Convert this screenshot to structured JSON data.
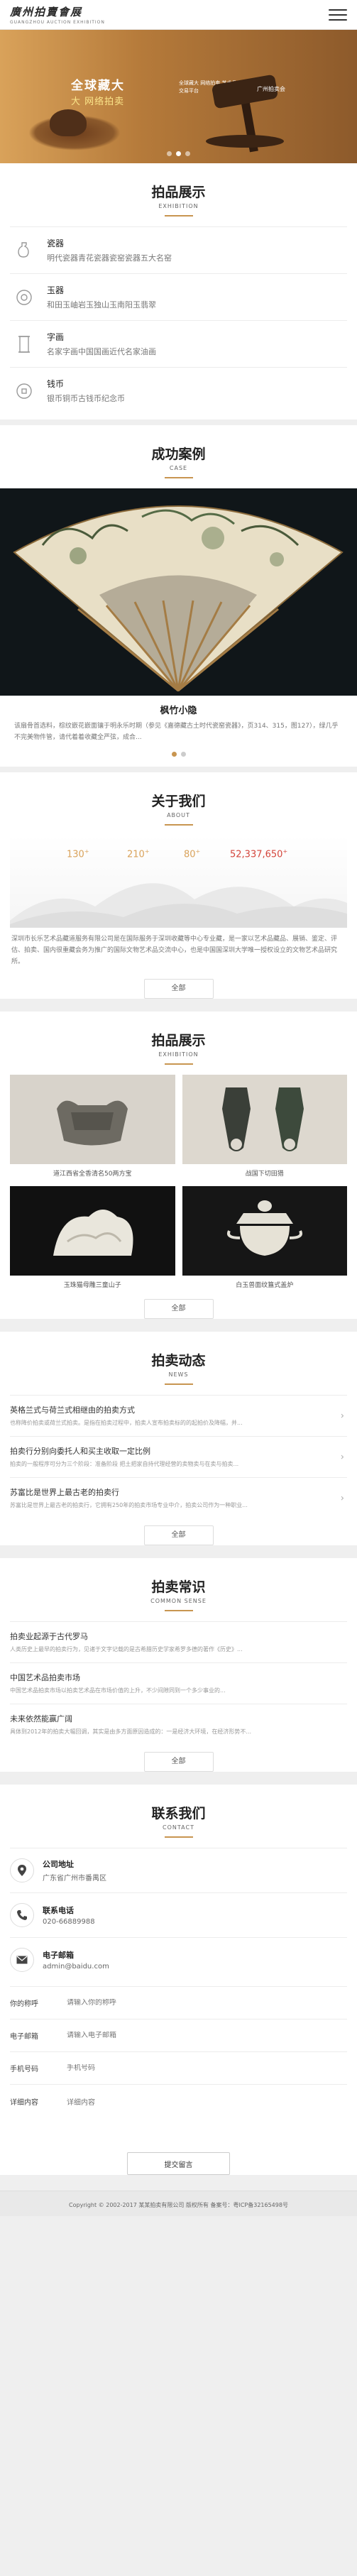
{
  "header": {
    "logo_cn": "廣州拍賣會展",
    "logo_en": "GUANGZHOU  AUCTION  EXHIBITION"
  },
  "banner": {
    "slogan1": "全球藏大",
    "slogan2": "大  网络拍卖",
    "tagline": "全球藏大 网络拍卖 艺术品交易平台",
    "tagline2": "广州拍卖会",
    "slides": 3,
    "active": 1
  },
  "products_section": {
    "title": "拍品展示",
    "subtitle": "EXHIBITION",
    "categories": [
      {
        "title": "瓷器",
        "desc": "明代瓷器青花瓷器瓷窑瓷器五大名窑",
        "icon": "vase-icon"
      },
      {
        "title": "玉器",
        "desc": "和田玉岫岩玉独山玉南阳玉翡翠",
        "icon": "jade-icon"
      },
      {
        "title": "字画",
        "desc": "名家字画中国国画近代名家油画",
        "icon": "scroll-icon"
      },
      {
        "title": "钱币",
        "desc": "银币铜币古钱币纪念币",
        "icon": "coin-icon"
      }
    ]
  },
  "case_section": {
    "title": "成功案例",
    "subtitle": "CASE",
    "item_title": "枫竹小隐",
    "item_desc": "该扇骨首选料，棕纹嵌花嵌面镶于明永乐时期（参见《嘉德藏古土时代瓷窑瓷器》，页314、315，图127），绿几乎不完美物件管，请代着着收藏全严弦，成合..."
  },
  "about_section": {
    "title": "关于我们",
    "subtitle": "ABOUT",
    "stats": [
      "130",
      "210",
      "80",
      "52,337,650"
    ],
    "text": "深圳市长乐艺术品藏道服务有限公司是在国际服务于深圳收藏等中心专业藏，是一家以艺术品藏品、展销、鉴定、评估、拍卖、国内很重藏会务为推广的国际文物艺术品交流中心，也是中国国深圳大学唯一授权设立的文物艺术品研究所。",
    "more": "全部"
  },
  "gallery_section": {
    "title": "拍品展示",
    "subtitle": "EXHIBITION",
    "items": [
      {
        "caption": "道江西省全香清名50两方宝"
      },
      {
        "caption": "战国下切田猎"
      },
      {
        "caption": "玉珠猫母雕三童山子"
      },
      {
        "caption": "白玉兽面纹簋式盖炉"
      }
    ],
    "more": "全部"
  },
  "news_section": {
    "title": "拍卖动态",
    "subtitle": "NEWS",
    "items": [
      {
        "title": "英格兰式与荷兰式相继由的拍卖方式",
        "desc": "也称降价拍卖或荷兰式拍卖。是指在拍卖过程中，拍卖人宣布拍卖标的的起拍价及降幅，并..."
      },
      {
        "title": "拍卖行分别向委托人和买主收取一定比例",
        "desc": "拍卖的一般程序可分为三个阶段：准备阶段 把土把家自持代理经营的卖物卖与在卖与拍卖..."
      },
      {
        "title": "苏富比是世界上最古老的拍卖行",
        "desc": "苏富比是世界上最古老的拍卖行，它拥有250年的拍卖市场专业中介，拍卖公司作为一种职业..."
      }
    ],
    "more": "全部"
  },
  "knowledge_section": {
    "title": "拍卖常识",
    "subtitle": "COMMON SENSE",
    "items": [
      {
        "title": "拍卖业起源于古代罗马",
        "desc": "人类历史上最早的拍卖行为，见诸于文字记载的是古希腊历史学家希罗多德的著作《历史》..."
      },
      {
        "title": "中国艺术品拍卖市场",
        "desc": "中国艺术品拍卖市场以拍卖艺术品在市场价值的上升，不少间隙同到一个多少事业的..."
      },
      {
        "title": "未来依然能赢广阔",
        "desc": "具体到2012年的拍卖大幅回调，其实是由多方面原因造成的：一是经济大环境，在经济形势不..."
      }
    ],
    "more": "全部"
  },
  "contact_section": {
    "title": "联系我们",
    "subtitle": "CONTACT",
    "items": [
      {
        "title": "公司地址",
        "value": "广东省广州市番禺区",
        "icon": "location-icon"
      },
      {
        "title": "联系电话",
        "value": "020-66889988",
        "icon": "phone-icon"
      },
      {
        "title": "电子邮箱",
        "value": "admin@baidu.com",
        "icon": "mail-icon"
      }
    ],
    "form": {
      "name_label": "你的称呼",
      "name_placeholder": "请输入你的称呼",
      "email_label": "电子邮箱",
      "email_placeholder": "请输入电子邮箱",
      "phone_label": "手机号码",
      "phone_placeholder": "手机号码",
      "message_label": "详细内容",
      "message_placeholder": "详细内容",
      "submit": "提交留言"
    }
  },
  "footer": {
    "text": "Copyright © 2002-2017 某某拍卖有限公司 版权所有 备案号：粤ICP备32165498号"
  },
  "colors": {
    "accent": "#c89550",
    "banner_bg": "#b57a3a",
    "about_stat_red": "#d4453b"
  }
}
